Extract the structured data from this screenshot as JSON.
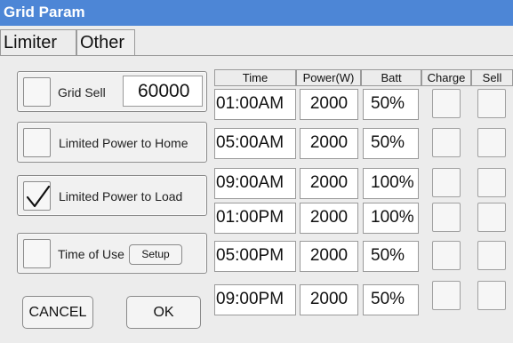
{
  "title": "Grid Param",
  "tabs": [
    "Limiter",
    "Other"
  ],
  "options": {
    "grid_sell": {
      "label": "Grid Sell",
      "value": "60000",
      "checked": false
    },
    "limited_home": {
      "label": "Limited Power to Home",
      "checked": false
    },
    "limited_load": {
      "label": "Limited Power to Load",
      "checked": true
    },
    "time_of_use": {
      "label": "Time of Use",
      "checked": false,
      "setup_label": "Setup"
    }
  },
  "buttons": {
    "cancel": "CANCEL",
    "ok": "OK"
  },
  "schedule": {
    "headers": {
      "time": "Time",
      "power": "Power(W)",
      "batt": "Batt",
      "charge": "Charge",
      "sell": "Sell"
    },
    "rows": [
      {
        "time": "01:00AM",
        "power": "2000",
        "batt": "50%",
        "charge": false,
        "sell": false
      },
      {
        "time": "05:00AM",
        "power": "2000",
        "batt": "50%",
        "charge": false,
        "sell": false
      },
      {
        "time": "09:00AM",
        "power": "2000",
        "batt": "100%",
        "charge": false,
        "sell": false
      },
      {
        "time": "01:00PM",
        "power": "2000",
        "batt": "100%",
        "charge": false,
        "sell": false
      },
      {
        "time": "05:00PM",
        "power": "2000",
        "batt": "50%",
        "charge": false,
        "sell": false
      },
      {
        "time": "09:00PM",
        "power": "2000",
        "batt": "50%",
        "charge": false,
        "sell": false
      }
    ]
  },
  "icons": {
    "checkmark": "checkmark-icon"
  },
  "colors": {
    "titlebar": "#4d86d6",
    "background": "#ececec"
  }
}
